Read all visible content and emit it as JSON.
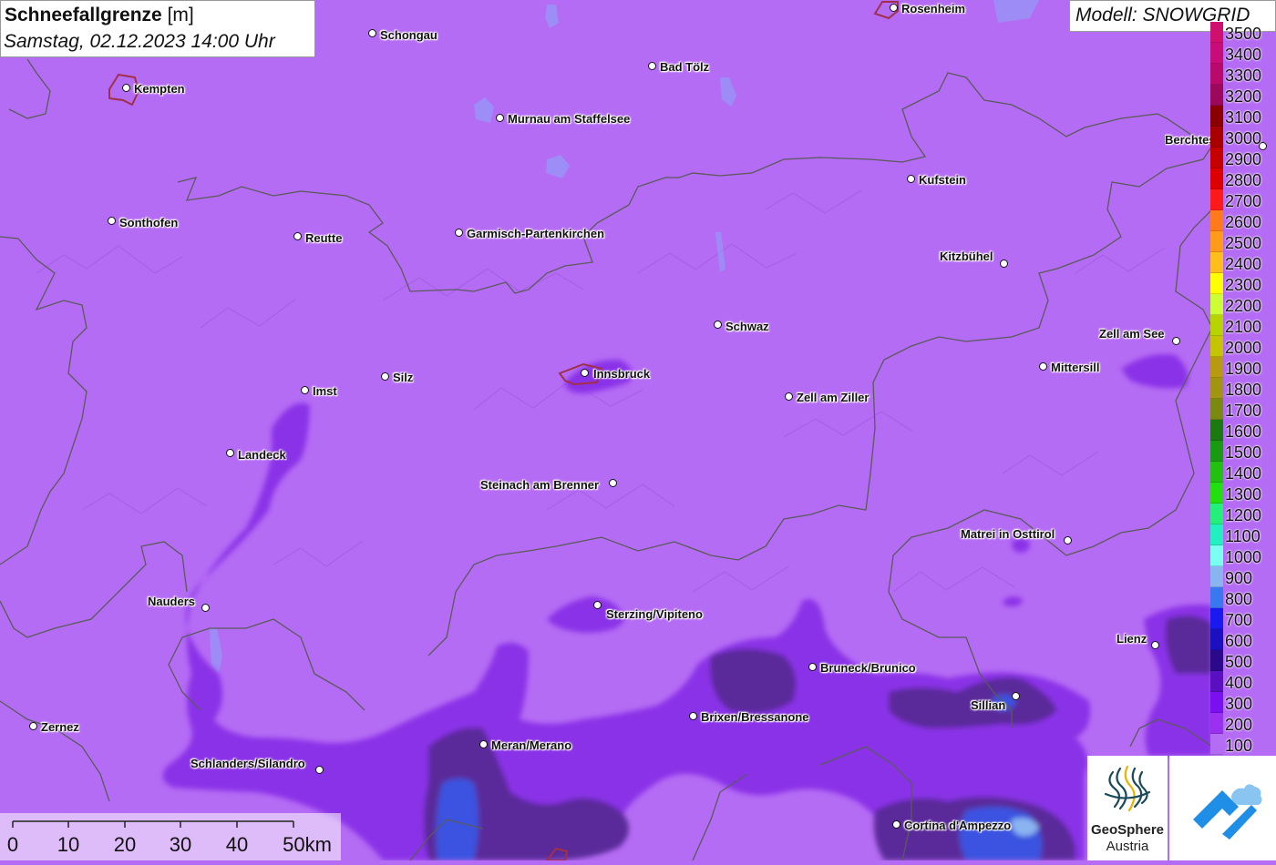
{
  "header": {
    "title": "Schneefallgrenze",
    "unit": "[m]",
    "subtitle": "Samstag, 02.12.2023 14:00 Uhr"
  },
  "model": {
    "label": "Modell: SNOWGRID"
  },
  "legend": {
    "levels": [
      {
        "label": "3500",
        "color": "#d0106e"
      },
      {
        "label": "3400",
        "color": "#c80c78"
      },
      {
        "label": "3300",
        "color": "#b80a6a"
      },
      {
        "label": "3200",
        "color": "#9c085a"
      },
      {
        "label": "3100",
        "color": "#8a0000"
      },
      {
        "label": "3000",
        "color": "#a80000"
      },
      {
        "label": "2900",
        "color": "#c40000"
      },
      {
        "label": "2800",
        "color": "#dc0000"
      },
      {
        "label": "2700",
        "color": "#ff1a1a"
      },
      {
        "label": "2600",
        "color": "#ff7a1a"
      },
      {
        "label": "2500",
        "color": "#ff9a1a"
      },
      {
        "label": "2400",
        "color": "#ffbe1a"
      },
      {
        "label": "2300",
        "color": "#ffff00"
      },
      {
        "label": "2200",
        "color": "#ccff33"
      },
      {
        "label": "2100",
        "color": "#b8d400"
      },
      {
        "label": "2000",
        "color": "#c4c400"
      },
      {
        "label": "1900",
        "color": "#b89a10"
      },
      {
        "label": "1800",
        "color": "#a09410"
      },
      {
        "label": "1700",
        "color": "#7a8a10"
      },
      {
        "label": "1600",
        "color": "#1a7a10"
      },
      {
        "label": "1500",
        "color": "#1a9a10"
      },
      {
        "label": "1400",
        "color": "#22c010"
      },
      {
        "label": "1300",
        "color": "#22e010"
      },
      {
        "label": "1200",
        "color": "#22f07a"
      },
      {
        "label": "1100",
        "color": "#22f0c0"
      },
      {
        "label": "1000",
        "color": "#7afff0"
      },
      {
        "label": "900",
        "color": "#8ab4f0"
      },
      {
        "label": "800",
        "color": "#3a78f0"
      },
      {
        "label": "700",
        "color": "#1a1af0"
      },
      {
        "label": "600",
        "color": "#1a10c0"
      },
      {
        "label": "500",
        "color": "#2a0a8a"
      },
      {
        "label": "400",
        "color": "#5a10c0"
      },
      {
        "label": "300",
        "color": "#7a10f0"
      },
      {
        "label": "200",
        "color": "#9a30f0"
      },
      {
        "label": "100",
        "color": "#b56cf4"
      }
    ]
  },
  "cities": [
    {
      "name": "Rosenheim",
      "label_side": "right"
    },
    {
      "name": "Schongau",
      "label_side": "right"
    },
    {
      "name": "Bad Tölz",
      "label_side": "right"
    },
    {
      "name": "Kempten",
      "label_side": "right"
    },
    {
      "name": "Murnau am Staffelsee",
      "label_side": "right"
    },
    {
      "name": "Berchtesgaden",
      "label_side": "left"
    },
    {
      "name": "Kufstein",
      "label_side": "right"
    },
    {
      "name": "Sonthofen",
      "label_side": "right"
    },
    {
      "name": "Reutte",
      "label_side": "right"
    },
    {
      "name": "Garmisch-Partenkirchen",
      "label_side": "right"
    },
    {
      "name": "Kitzbühel",
      "label_side": "left"
    },
    {
      "name": "Schwaz",
      "label_side": "right"
    },
    {
      "name": "Zell am See",
      "label_side": "left"
    },
    {
      "name": "Mittersill",
      "label_side": "right"
    },
    {
      "name": "Innsbruck",
      "label_side": "right"
    },
    {
      "name": "Silz",
      "label_side": "right"
    },
    {
      "name": "Imst",
      "label_side": "right"
    },
    {
      "name": "Zell am Ziller",
      "label_side": "right"
    },
    {
      "name": "Landeck",
      "label_side": "right"
    },
    {
      "name": "Steinach am Brenner",
      "label_side": "left"
    },
    {
      "name": "Matrei in Osttirol",
      "label_side": "left"
    },
    {
      "name": "Nauders",
      "label_side": "left"
    },
    {
      "name": "Sterzing/Vipiteno",
      "label_side": "right"
    },
    {
      "name": "Lienz",
      "label_side": "left"
    },
    {
      "name": "Bruneck/Brunico",
      "label_side": "right"
    },
    {
      "name": "Sillian",
      "label_side": "left"
    },
    {
      "name": "Brixen/Bressanone",
      "label_side": "right"
    },
    {
      "name": "Zernez",
      "label_side": "right"
    },
    {
      "name": "Meran/Merano",
      "label_side": "right"
    },
    {
      "name": "Schlanders/Silandro",
      "label_side": "left"
    },
    {
      "name": "Cortina d'Ampezzo",
      "label_side": "right"
    }
  ],
  "scale_bar": {
    "ticks": [
      "0",
      "10",
      "20",
      "30",
      "40",
      "50km"
    ]
  },
  "logos": {
    "geosphere_line1": "GeoSphere",
    "geosphere_line2": "Austria"
  },
  "colors": {
    "base": "#b56cf4",
    "level_200_300": "#8a30e8",
    "level_400_500": "#5a2a9a",
    "level_700_800": "#3a52e0",
    "border": "#5a5a5a",
    "city_boundary": "#a0304a",
    "brand_blue": "#1e8ee6"
  }
}
